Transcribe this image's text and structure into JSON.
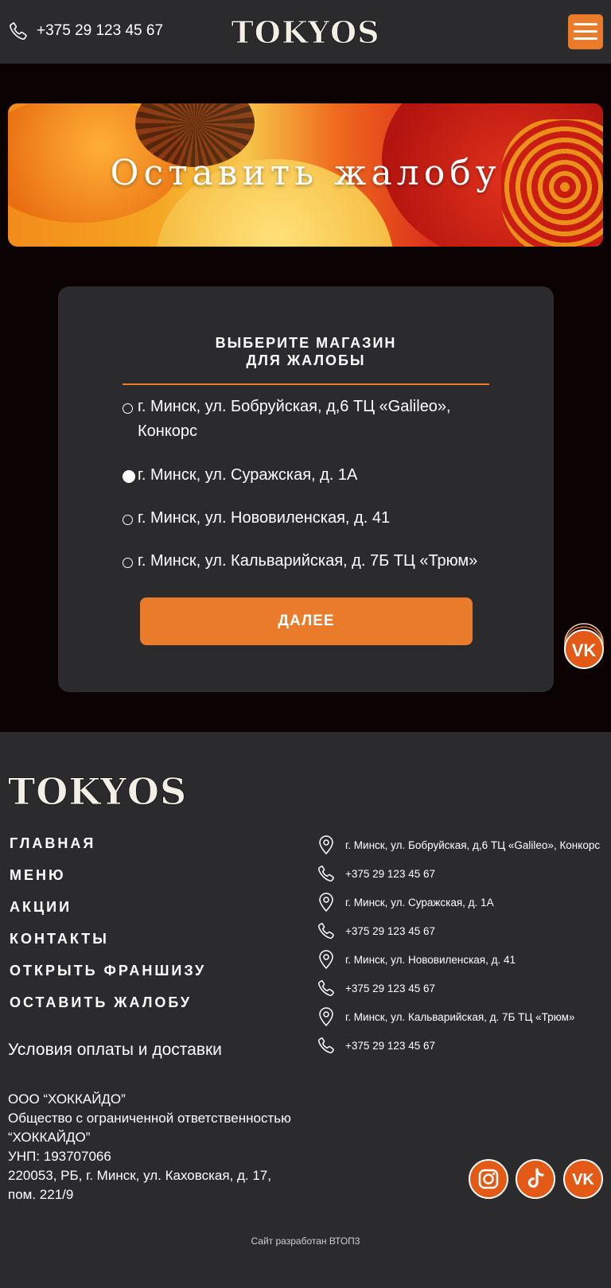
{
  "header": {
    "phone": "+375 29 123 45 67",
    "logo": "TOKYOS",
    "menu_icon": "hamburger-menu-icon"
  },
  "banner": {
    "title": "Оставить жалобу"
  },
  "form": {
    "heading_line1": "ВЫБЕРИТЕ МАГАЗИН",
    "heading_line2": "ДЛЯ ЖАЛОБЫ",
    "stores": [
      {
        "label": "г. Минск, ул. Бобруйская, д,6 ТЦ «Galileo», Конкорс",
        "selected": false
      },
      {
        "label": "г. Минск, ул. Суражская, д. 1А",
        "selected": true
      },
      {
        "label": "г. Минск, ул. Нововиленская, д. 41",
        "selected": false
      },
      {
        "label": "г. Минск, ул. Кальварийская, д. 7Б ТЦ «Трюм»",
        "selected": false
      }
    ],
    "next_label": "ДАЛЕЕ"
  },
  "footer": {
    "logo": "TOKYOS",
    "nav": [
      "ГЛАВНАЯ",
      "МЕНЮ",
      "АКЦИИ",
      "КОНТАКТЫ",
      "ОТКРЫТЬ ФРАНШИЗУ",
      "ОСТАВИТЬ ЖАЛОБУ"
    ],
    "terms": "Условия оплаты и доставки",
    "company": {
      "line1": "ООО “ХОККАЙДО”",
      "line2": "Общество с ограниченной ответственностью",
      "line3": "“ХОККАЙДО”",
      "line4": "УНП: 193707066",
      "line5": "220053, РБ, г. Минск, ул. Каховская, д. 17,",
      "line6": "пом. 221/9"
    },
    "contacts": [
      {
        "type": "location-icon",
        "text": "г. Минск, ул. Бобруйская, д,6 ТЦ «Galileo», Конкорс"
      },
      {
        "type": "phone-icon",
        "text": "+375 29 123 45 67"
      },
      {
        "type": "location-icon",
        "text": "г. Минск, ул. Суражская, д. 1А"
      },
      {
        "type": "phone-icon",
        "text": "+375 29 123 45 67"
      },
      {
        "type": "location-icon",
        "text": "г. Минск, ул. Нововиленская, д. 41"
      },
      {
        "type": "phone-icon",
        "text": "+375 29 123 45 67"
      },
      {
        "type": "location-icon",
        "text": "г. Минск, ул. Кальварийская, д. 7Б ТЦ «Трюм»"
      },
      {
        "type": "phone-icon",
        "text": "+375 29 123 45 67"
      }
    ],
    "social": [
      "instagram-icon",
      "tiktok-icon",
      "vk-icon"
    ],
    "credit": "Сайт разработан ВТОП3"
  },
  "colors": {
    "accent": "#ea7b2b",
    "panel": "#2b2b2d",
    "page_bg": "#0b0203"
  }
}
